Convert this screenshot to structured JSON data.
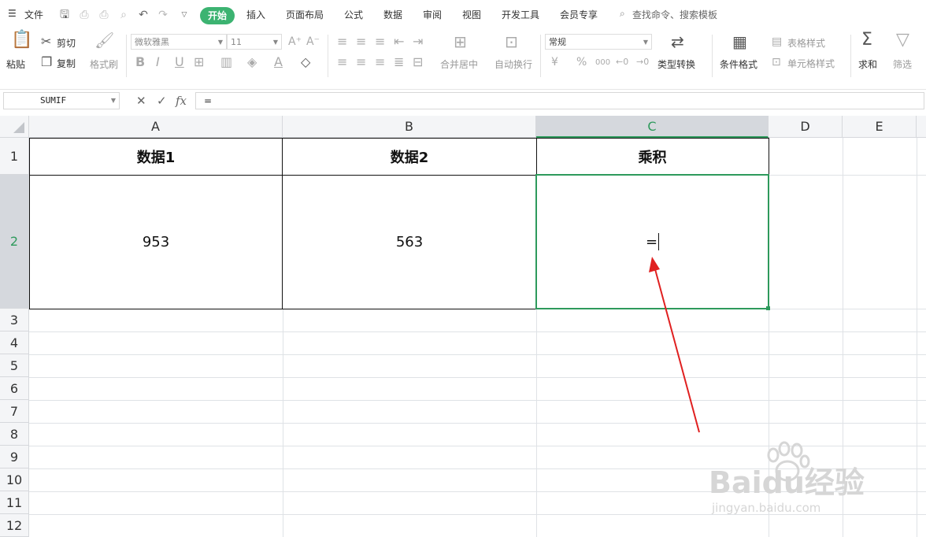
{
  "menu": {
    "file": "文件",
    "tabs": [
      "开始",
      "插入",
      "页面布局",
      "公式",
      "数据",
      "审阅",
      "视图",
      "开发工具",
      "会员专享"
    ],
    "search": "查找命令、搜索模板"
  },
  "ribbon": {
    "paste": "粘贴",
    "cut": "剪切",
    "copy": "复制",
    "format_painter": "格式刷",
    "font_name": "微软雅黑",
    "font_size": "11",
    "merge_center": "合并居中",
    "auto_wrap": "自动换行",
    "number_format": "常规",
    "type_convert": "类型转换",
    "cond_format": "条件格式",
    "table_style": "表格样式",
    "cell_style": "单元格样式",
    "sum": "求和",
    "filter": "筛选",
    "currency_symbol": "¥",
    "percent_symbol": "%",
    "thousands_symbol": "000"
  },
  "formula_bar": {
    "name_box": "SUMIF",
    "fx_label": "fx",
    "formula": "="
  },
  "sheet": {
    "columns": [
      "A",
      "B",
      "C",
      "D",
      "E"
    ],
    "active_column": "C",
    "rows": [
      "1",
      "2",
      "3",
      "4",
      "5",
      "6",
      "7",
      "8",
      "9",
      "10",
      "11",
      "12"
    ],
    "active_row": "2",
    "header_row": [
      "数据1",
      "数据2",
      "乘积"
    ],
    "data_row": [
      "953",
      "563",
      "="
    ]
  },
  "watermark": {
    "brand": "Baidu经验",
    "url": "jingyan.baidu.com"
  },
  "colors": {
    "accent": "#3cb371",
    "selection": "#2e9a5c",
    "arrow": "#e02020"
  }
}
